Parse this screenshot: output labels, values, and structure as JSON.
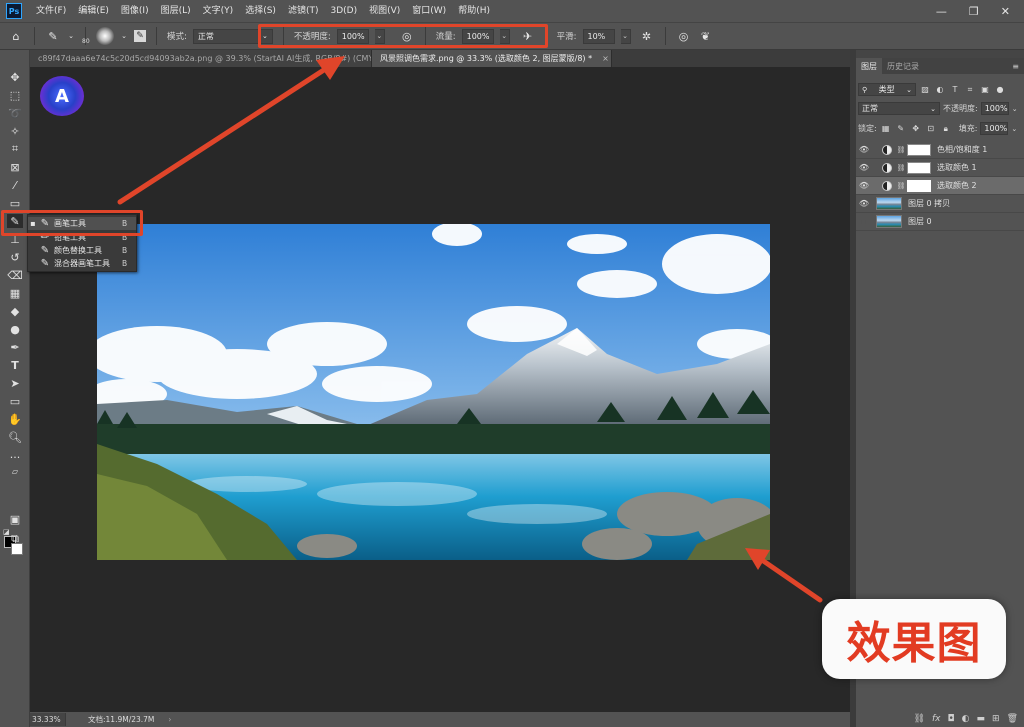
{
  "app": {
    "logo_text": "Ps"
  },
  "menu": [
    "文件(F)",
    "编辑(E)",
    "图像(I)",
    "图层(L)",
    "文字(Y)",
    "选择(S)",
    "滤镜(T)",
    "3D(D)",
    "视图(V)",
    "窗口(W)",
    "帮助(H)"
  ],
  "window_controls": {
    "minimize": "—",
    "maximize": "❐",
    "close": "✕"
  },
  "options": {
    "brush_size": "80",
    "mode_label": "模式:",
    "mode_value": "正常",
    "opacity_label": "不透明度:",
    "opacity_value": "100%",
    "flow_label": "流量:",
    "flow_value": "100%",
    "smoothing_label": "平滑:",
    "smoothing_value": "10%"
  },
  "tabs": [
    {
      "title": "c89f47daaa6e74c5c20d5cd94093ab2a.png @ 39.3% (StartAI AI生成, RGB/8#) (CMYK) *",
      "close": "×",
      "active": false
    },
    {
      "title": "风景照调色需求.png @ 33.3% (选取颜色 2, 图层蒙版/8) *",
      "close": "×",
      "active": true
    }
  ],
  "canvas_logo": "A",
  "flyout": [
    {
      "label": "画笔工具",
      "shortcut": "B",
      "selected": true
    },
    {
      "label": "铅笔工具",
      "shortcut": "B",
      "selected": false
    },
    {
      "label": "颜色替换工具",
      "shortcut": "B",
      "selected": false
    },
    {
      "label": "混合器画笔工具",
      "shortcut": "B",
      "selected": false
    }
  ],
  "status": {
    "zoom": "33.33%",
    "doc_info": "文档:11.9M/23.7M",
    "arrow": "›"
  },
  "panel": {
    "tabs": [
      "图层",
      "历史记录"
    ],
    "filter_label": "类型",
    "blend_mode": "正常",
    "opacity_label": "不透明度:",
    "opacity_value": "100%",
    "lock_label": "锁定:",
    "fill_label": "填充:",
    "fill_value": "100%",
    "layers": [
      {
        "name": "色相/饱和度 1",
        "kind": "adjustment",
        "visible": true,
        "active": false
      },
      {
        "name": "选取颜色 1",
        "kind": "adjustment",
        "visible": true,
        "active": false
      },
      {
        "name": "选取颜色 2",
        "kind": "adjustment",
        "visible": true,
        "active": true
      },
      {
        "name": "图层 0 拷贝",
        "kind": "image",
        "visible": true,
        "active": false
      },
      {
        "name": "图层 0",
        "kind": "image",
        "visible": false,
        "active": false
      }
    ]
  },
  "annotation": {
    "callout_text": "效果图",
    "color": "#e0452a"
  }
}
